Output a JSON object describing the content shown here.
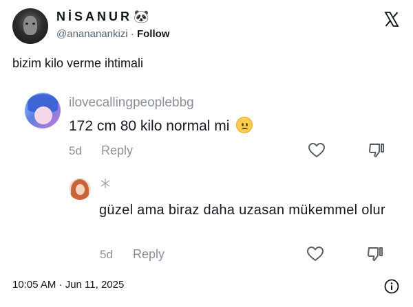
{
  "author": {
    "display_name": "NİSANUR",
    "display_emoji": "🐼",
    "handle": "@ananananki zi",
    "handle_text": "@anananankizi",
    "separator": " · ",
    "follow_label": "Follow"
  },
  "post": {
    "text": "bizim kilo verme ihtimali",
    "timestamp": "10:05 AM · Jun 11, 2025"
  },
  "embedded_comments": {
    "comment1": {
      "username": "ilovecallingpeoplebbg",
      "text": "172 cm 80 kilo normal mi",
      "age": "5d",
      "reply_label": "Reply"
    },
    "comment2": {
      "text": "güzel ama biraz daha uzasan mükemmel olur",
      "age": "5d",
      "reply_label": "Reply"
    }
  },
  "icons": {
    "brand": "x-logo-icon",
    "like": "heart-icon",
    "dislike": "thumbs-down-icon",
    "info": "info-icon"
  },
  "colors": {
    "text_primary": "#0f1419",
    "text_secondary": "#536471",
    "comment_meta": "#8a8f98"
  }
}
